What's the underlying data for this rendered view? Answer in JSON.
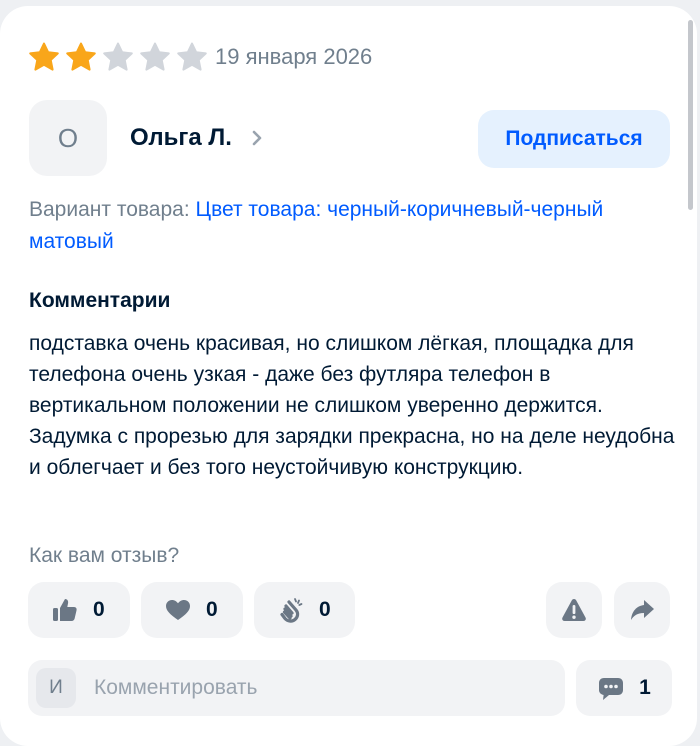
{
  "review": {
    "rating": 2,
    "rating_max": 5,
    "date": "19 января 2026",
    "author": {
      "initial": "О",
      "name": "Ольга Л."
    },
    "subscribe_label": "Подписаться",
    "variant": {
      "label": "Вариант товара:",
      "attribute": "Цвет товара:",
      "value": "черный-коричневый-черный матовый"
    },
    "comment_heading": "Комментарии",
    "text": "подставка очень красивая, но слишком лёгкая, площадка для телефона очень узкая - даже без футляра телефон в вертикальном положении не слишком уверенно держится. Задумка с прорезью для зарядки прекрасна, но на деле неудобна и облегчает и без того неустойчивую конструкцию."
  },
  "feedback": {
    "question": "Как вам отзыв?",
    "reactions": [
      {
        "icon": "thumbs-up-icon",
        "count": "0"
      },
      {
        "icon": "heart-icon",
        "count": "0"
      },
      {
        "icon": "clapping-hands-icon",
        "count": "0"
      }
    ],
    "actions": [
      {
        "icon": "warning-icon"
      },
      {
        "icon": "share-icon"
      }
    ]
  },
  "comment_form": {
    "user_initial": "И",
    "placeholder": "Комментировать",
    "comments_count": "1"
  },
  "colors": {
    "star_filled": "#f9a61a",
    "star_empty": "#d1d5db",
    "accent": "#005bff",
    "text": "#001a34",
    "muted": "#707f8d"
  }
}
